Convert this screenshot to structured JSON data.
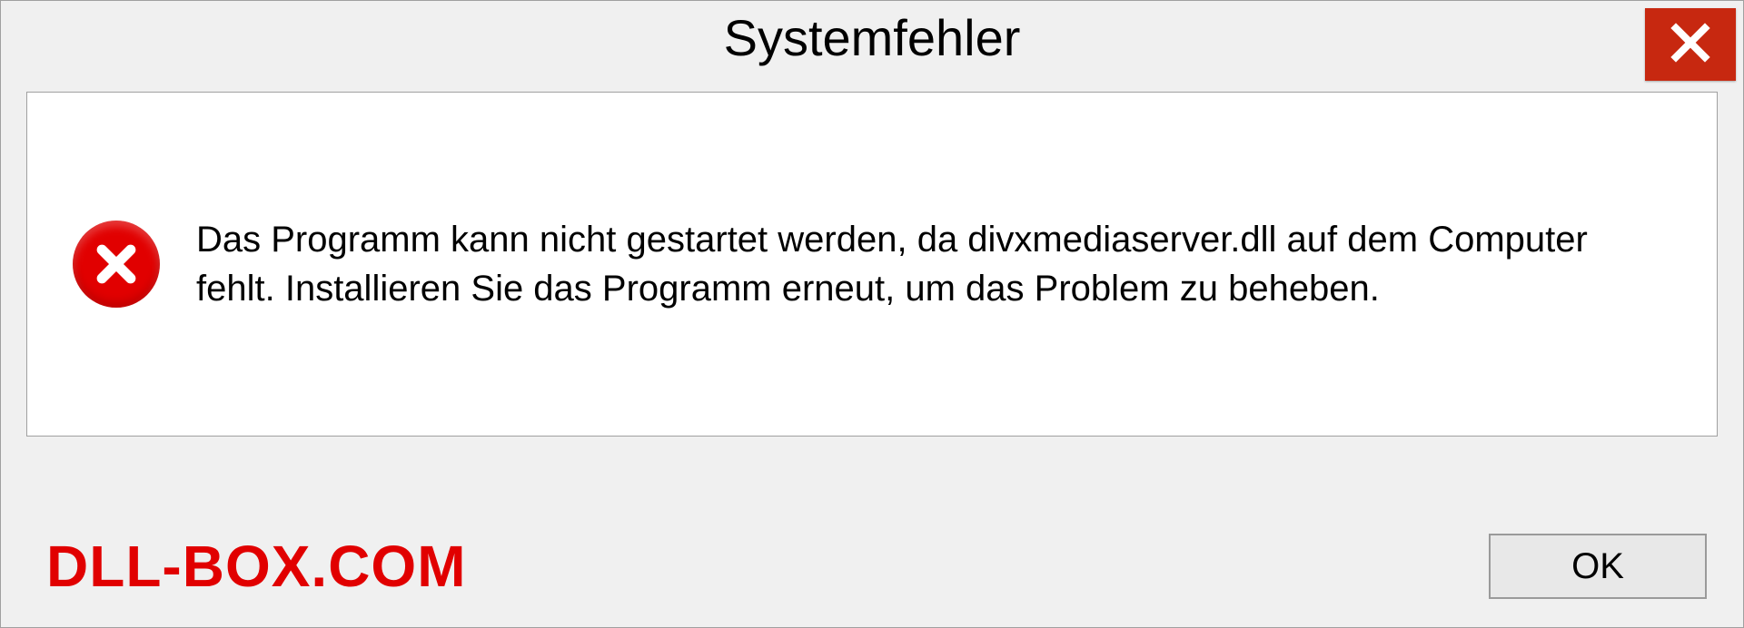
{
  "titlebar": {
    "title": "Systemfehler"
  },
  "content": {
    "message": "Das Programm kann nicht gestartet werden, da divxmediaserver.dll auf dem Computer fehlt. Installieren Sie das Programm erneut, um das Problem zu beheben."
  },
  "bottom": {
    "branding": "DLL-BOX.COM",
    "ok_label": "OK"
  }
}
